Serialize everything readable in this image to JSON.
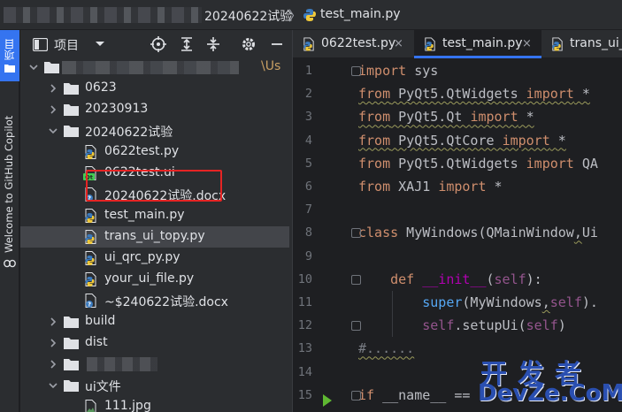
{
  "breadcrumb": {
    "folder": "20240622试验",
    "separator": "〉",
    "file": "test_main.py"
  },
  "stripe": {
    "project_label": "项目",
    "copilot_label": "Welcome to GitHub Copilot"
  },
  "project_pane": {
    "title": "项目",
    "root_suffix": "\\Us",
    "tree": [
      {
        "label": "",
        "type": "root-folder",
        "expanded": true
      },
      {
        "label": "0623",
        "type": "folder",
        "expanded": false
      },
      {
        "label": "20230913",
        "type": "folder",
        "expanded": false
      },
      {
        "label": "20240622试验",
        "type": "folder",
        "expanded": true
      },
      {
        "label": "0622test.py",
        "type": "python"
      },
      {
        "label": "0622test.ui",
        "type": "qt-ui"
      },
      {
        "label": "20240622试验.docx",
        "type": "unknown"
      },
      {
        "label": "test_main.py",
        "type": "python"
      },
      {
        "label": "trans_ui_topy.py",
        "type": "python",
        "selected": true
      },
      {
        "label": "ui_qrc_py.py",
        "type": "python"
      },
      {
        "label": "your_ui_file.py",
        "type": "python"
      },
      {
        "label": "~$240622试验.docx",
        "type": "unknown"
      },
      {
        "label": "build",
        "type": "folder",
        "expanded": false
      },
      {
        "label": "dist",
        "type": "folder",
        "expanded": false
      },
      {
        "label": "",
        "type": "folder",
        "expanded": false
      },
      {
        "label": "ui文件",
        "type": "folder",
        "expanded": true
      },
      {
        "label": "111.jpg",
        "type": "image"
      }
    ]
  },
  "tabs": [
    {
      "label": "0622test.py",
      "close": "×",
      "active": false
    },
    {
      "label": "test_main.py",
      "close": "×",
      "active": true
    },
    {
      "label": "trans_ui_to",
      "close": "",
      "active": false
    }
  ],
  "code_lines": [
    {
      "n": "1",
      "segments": [
        {
          "t": "import",
          "c": "kw"
        },
        {
          "t": " sys",
          "c": "tx"
        }
      ]
    },
    {
      "n": "2",
      "segments": [
        {
          "t": "from",
          "c": "kw",
          "w": true
        },
        {
          "t": " PyQt5.QtWidgets ",
          "c": "tx",
          "w": true
        },
        {
          "t": "import",
          "c": "kw",
          "w": true
        },
        {
          "t": " *",
          "c": "tx",
          "w": true
        }
      ]
    },
    {
      "n": "3",
      "segments": [
        {
          "t": "from",
          "c": "kw",
          "w": true
        },
        {
          "t": " PyQt5.Qt ",
          "c": "tx",
          "w": true
        },
        {
          "t": "import",
          "c": "kw",
          "w": true
        },
        {
          "t": " *",
          "c": "tx",
          "w": true
        }
      ]
    },
    {
      "n": "4",
      "segments": [
        {
          "t": "from",
          "c": "kw",
          "w": true
        },
        {
          "t": " PyQt5.QtCore ",
          "c": "tx",
          "w": true
        },
        {
          "t": "import",
          "c": "kw",
          "w": true
        },
        {
          "t": " *",
          "c": "tx",
          "w": true
        }
      ]
    },
    {
      "n": "5",
      "segments": [
        {
          "t": "from",
          "c": "kw"
        },
        {
          "t": " PyQt5.QtWidgets ",
          "c": "tx"
        },
        {
          "t": "import",
          "c": "kw"
        },
        {
          "t": " QA",
          "c": "tx"
        }
      ]
    },
    {
      "n": "6",
      "segments": [
        {
          "t": "from",
          "c": "kw"
        },
        {
          "t": " XAJ1 ",
          "c": "tx"
        },
        {
          "t": "import",
          "c": "kw"
        },
        {
          "t": " *",
          "c": "tx"
        }
      ]
    },
    {
      "n": "7",
      "segments": []
    },
    {
      "n": "8",
      "segments": [
        {
          "t": "class",
          "c": "kw"
        },
        {
          "t": " MyWindows(QMainWindow",
          "c": "tx"
        },
        {
          "t": ",",
          "c": "tx",
          "w": true
        },
        {
          "t": "Ui",
          "c": "tx"
        }
      ]
    },
    {
      "n": "9",
      "segments": []
    },
    {
      "n": "10",
      "segments": [
        {
          "t": "    ",
          "c": "tx"
        },
        {
          "t": "def",
          "c": "kw"
        },
        {
          "t": " ",
          "c": "tx"
        },
        {
          "t": "__init__",
          "c": "dm"
        },
        {
          "t": "(",
          "c": "tx"
        },
        {
          "t": "self",
          "c": "sf"
        },
        {
          "t": "):",
          "c": "tx"
        }
      ]
    },
    {
      "n": "11",
      "segments": [
        {
          "t": "        ",
          "c": "tx"
        },
        {
          "t": "super",
          "c": "fn"
        },
        {
          "t": "(MyWindows",
          "c": "tx"
        },
        {
          "t": ",",
          "c": "tx",
          "w": true
        },
        {
          "t": "self",
          "c": "sf"
        },
        {
          "t": ").",
          "c": "tx"
        }
      ]
    },
    {
      "n": "12",
      "segments": [
        {
          "t": "        ",
          "c": "tx"
        },
        {
          "t": "self",
          "c": "sf"
        },
        {
          "t": ".setupUi(",
          "c": "tx"
        },
        {
          "t": "self",
          "c": "sf"
        },
        {
          "t": ")",
          "c": "tx"
        }
      ]
    },
    {
      "n": "13",
      "segments": [
        {
          "t": "#......",
          "c": "cm",
          "w": true
        }
      ]
    },
    {
      "n": "14",
      "segments": []
    },
    {
      "n": "15",
      "segments": [
        {
          "t": "if",
          "c": "kw"
        },
        {
          "t": " __name__ ",
          "c": "tx"
        },
        {
          "t": "==",
          "c": "tx"
        }
      ]
    }
  ],
  "watermark": {
    "zh": "开发者",
    "en": "DevZe.CoM"
  },
  "colors": {
    "accent": "#3574f0",
    "highlight_box": "#e62424",
    "keyword": "#cf8e6d",
    "function": "#56a8f5",
    "self": "#94558d",
    "dunder": "#b200b2",
    "comment": "#7a7e85",
    "run_icon": "#5fb832",
    "watermark": "#2a4fb0"
  },
  "icons": {
    "folder": "folder-icon",
    "python": "python-file-icon",
    "qt_ui": "qt-ui-file-icon",
    "unknown": "unknown-file-icon",
    "image": "image-file-icon",
    "target": "locate-icon",
    "expand_all": "expand-all-icon",
    "collapse_all": "collapse-all-icon",
    "gear": "gear-icon",
    "minimize": "minimize-icon",
    "run": "run-icon"
  }
}
